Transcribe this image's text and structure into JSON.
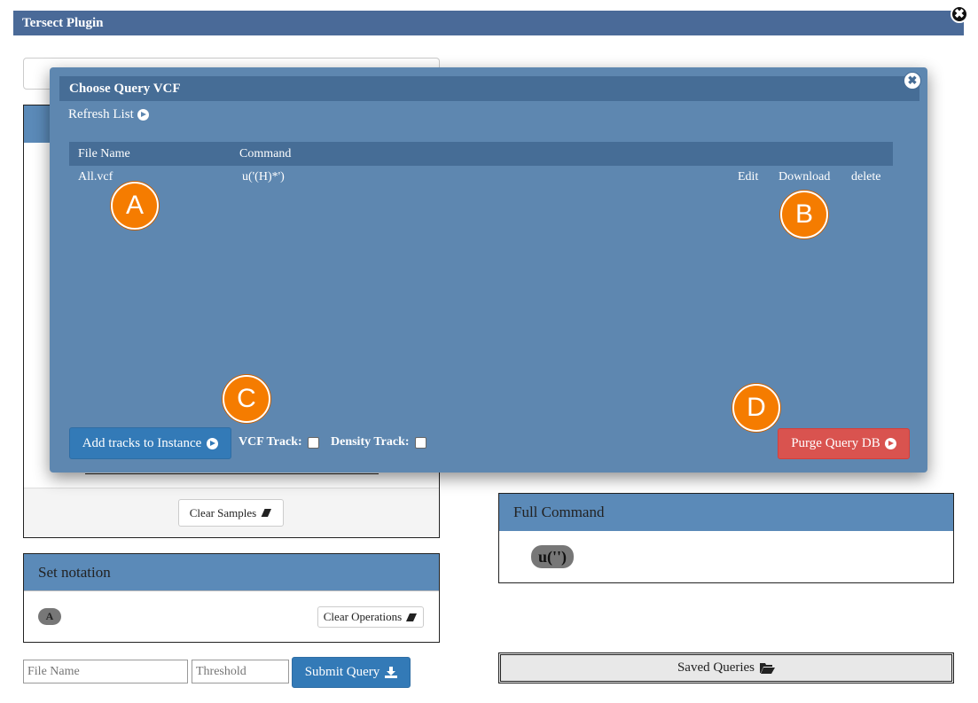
{
  "outer": {
    "title": "Tersect Plugin",
    "close_symbol": "✖"
  },
  "samples_panel": {
    "clear_label": "Clear Samples"
  },
  "set_notation": {
    "title": "Set notation",
    "badge": "A",
    "clear_label": "Clear Operations"
  },
  "full_command": {
    "title": "Full Command",
    "value": "u('')"
  },
  "query_form": {
    "file_name_placeholder": "File Name",
    "threshold_placeholder": "Threshold",
    "submit_label": "Submit Query"
  },
  "saved_queries": {
    "label": "Saved Queries"
  },
  "modal": {
    "title": "Choose Query VCF",
    "close_symbol": "✖",
    "refresh_label": "Refresh List",
    "columns": [
      "File Name",
      "Command"
    ],
    "rows": [
      {
        "file": "All.vcf",
        "command": "u('(H)*')",
        "edit": "Edit",
        "download": "Download",
        "delete": "delete"
      }
    ],
    "add_tracks_label": "Add tracks to Instance",
    "vcf_track_label": "VCF Track:",
    "density_track_label": "Density Track:",
    "purge_label": "Purge Query DB"
  },
  "markers": [
    "A",
    "B",
    "C",
    "D"
  ],
  "colors": {
    "header_blue": "#4a6a98",
    "modal_blue": "#5e87b0",
    "primary_button": "#337ab7",
    "danger_button": "#d9534f",
    "marker_orange": "#f57c00"
  }
}
